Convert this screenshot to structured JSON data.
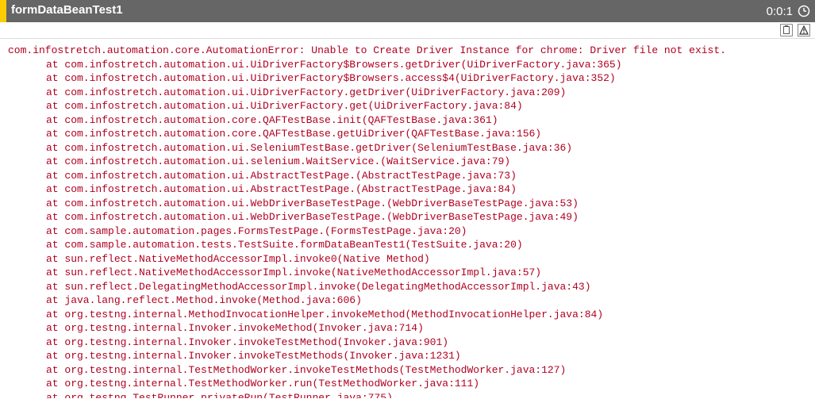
{
  "header": {
    "title": "formDataBeanTest1",
    "timer": "0:0:1"
  },
  "error": {
    "message": "com.infostretch.automation.core.AutomationError: Unable to Create Driver Instance for chrome: Driver file not exist.",
    "frames": [
      "at com.infostretch.automation.ui.UiDriverFactory$Browsers.getDriver(UiDriverFactory.java:365)",
      "at com.infostretch.automation.ui.UiDriverFactory$Browsers.access$4(UiDriverFactory.java:352)",
      "at com.infostretch.automation.ui.UiDriverFactory.getDriver(UiDriverFactory.java:209)",
      "at com.infostretch.automation.ui.UiDriverFactory.get(UiDriverFactory.java:84)",
      "at com.infostretch.automation.core.QAFTestBase.init(QAFTestBase.java:361)",
      "at com.infostretch.automation.core.QAFTestBase.getUiDriver(QAFTestBase.java:156)",
      "at com.infostretch.automation.ui.SeleniumTestBase.getDriver(SeleniumTestBase.java:36)",
      "at com.infostretch.automation.ui.selenium.WaitService.(WaitService.java:79)",
      "at com.infostretch.automation.ui.AbstractTestPage.(AbstractTestPage.java:73)",
      "at com.infostretch.automation.ui.AbstractTestPage.(AbstractTestPage.java:84)",
      "at com.infostretch.automation.ui.WebDriverBaseTestPage.(WebDriverBaseTestPage.java:53)",
      "at com.infostretch.automation.ui.WebDriverBaseTestPage.(WebDriverBaseTestPage.java:49)",
      "at com.sample.automation.pages.FormsTestPage.(FormsTestPage.java:20)",
      "at com.sample.automation.tests.TestSuite.formDataBeanTest1(TestSuite.java:20)",
      "at sun.reflect.NativeMethodAccessorImpl.invoke0(Native Method)",
      "at sun.reflect.NativeMethodAccessorImpl.invoke(NativeMethodAccessorImpl.java:57)",
      "at sun.reflect.DelegatingMethodAccessorImpl.invoke(DelegatingMethodAccessorImpl.java:43)",
      "at java.lang.reflect.Method.invoke(Method.java:606)",
      "at org.testng.internal.MethodInvocationHelper.invokeMethod(MethodInvocationHelper.java:84)",
      "at org.testng.internal.Invoker.invokeMethod(Invoker.java:714)",
      "at org.testng.internal.Invoker.invokeTestMethod(Invoker.java:901)",
      "at org.testng.internal.Invoker.invokeTestMethods(Invoker.java:1231)",
      "at org.testng.internal.TestMethodWorker.invokeTestMethods(TestMethodWorker.java:127)",
      "at org.testng.internal.TestMethodWorker.run(TestMethodWorker.java:111)",
      "at org.testng.TestRunner.privateRun(TestRunner.java:775)"
    ]
  }
}
